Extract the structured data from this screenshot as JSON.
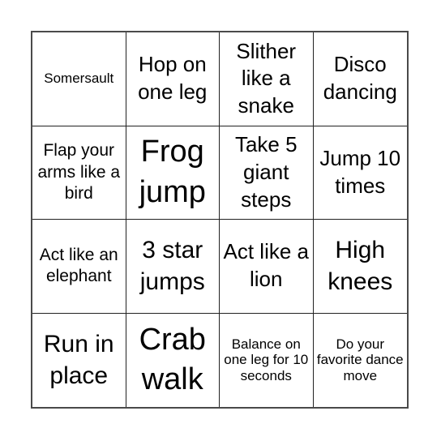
{
  "board": {
    "cells": [
      "Somersault",
      "Hop on one leg",
      "Slither like a snake",
      "Disco dancing",
      "Flap your arms like a bird",
      "Frog jump",
      "Take 5 giant steps",
      "Jump 10 times",
      "Act like an elephant",
      "3 star jumps",
      "Act like a lion",
      "High knees",
      "Run in place",
      "Crab walk",
      "Balance on one leg for 10 seconds",
      "Do your favorite dance move"
    ]
  }
}
